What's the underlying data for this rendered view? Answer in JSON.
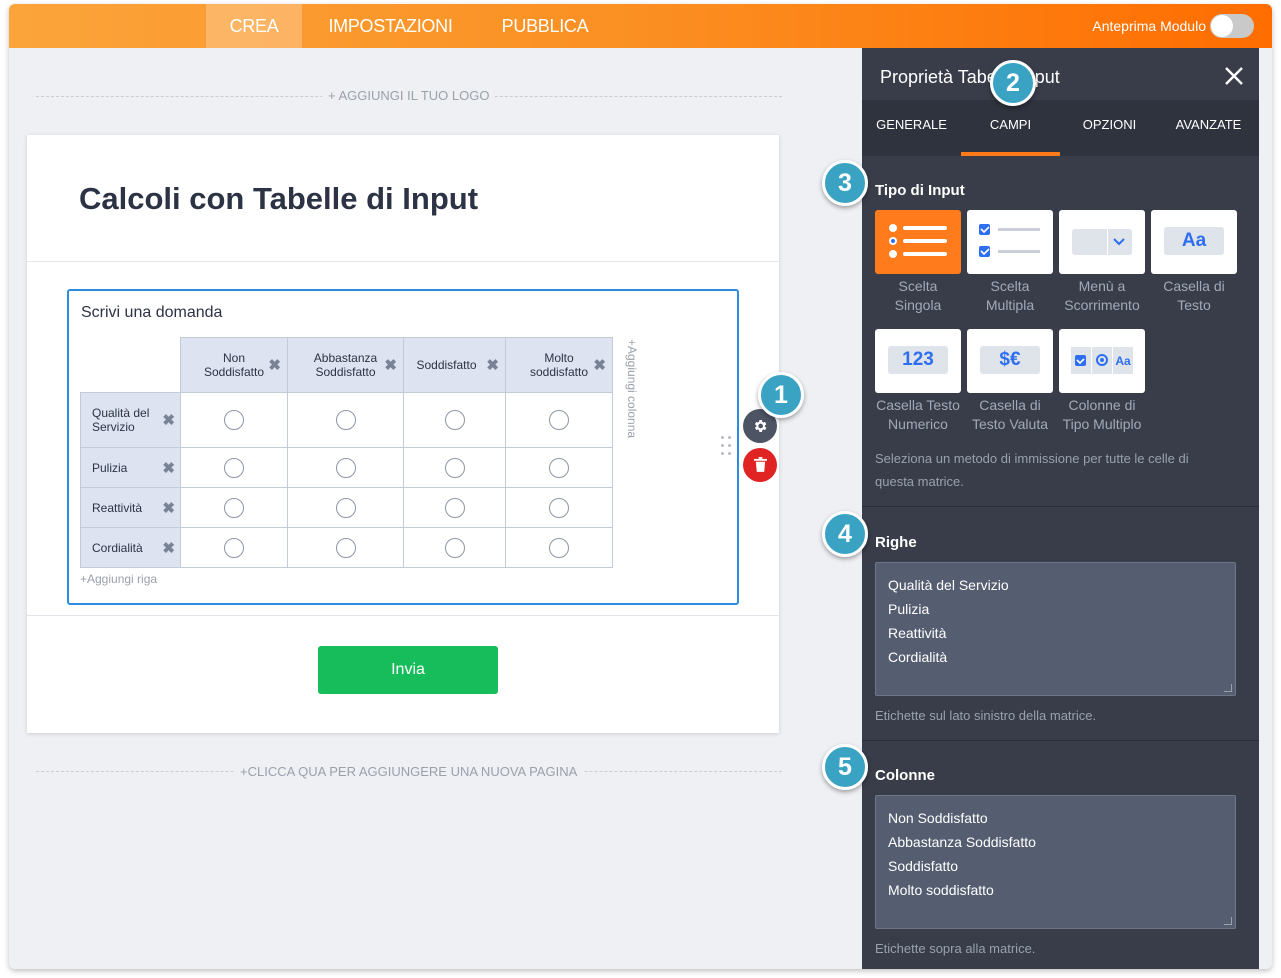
{
  "topbar": {
    "tabs": [
      "CREA",
      "IMPOSTAZIONI",
      "PUBBLICA"
    ],
    "preview_label": "Anteprima Modulo"
  },
  "canvas": {
    "add_logo": "+ AGGIUNGI IL TUO LOGO",
    "add_page": "+CLICCA QUA PER AGGIUNGERE UNA NUOVA PAGINA",
    "form_title": "Calcoli con Tabelle di Input",
    "question_label": "Scrivi una domanda",
    "columns": [
      {
        "line1": "Non",
        "line2": "Soddisfatto"
      },
      {
        "line1": "Abbastanza",
        "line2": "Soddisfatto"
      },
      {
        "line1": "Soddisfatto",
        "line2": ""
      },
      {
        "line1": "Molto",
        "line2": "soddisfatto"
      }
    ],
    "rows": [
      {
        "line1": "Qualità del",
        "line2": "Servizio"
      },
      {
        "line1": "Pulizia",
        "line2": ""
      },
      {
        "line1": "Reattività",
        "line2": ""
      },
      {
        "line1": "Cordialità",
        "line2": ""
      }
    ],
    "add_column": "+Aggiungi colonna",
    "add_row": "+Aggiungi riga",
    "submit_label": "Invia",
    "delete_icon": "✖"
  },
  "panel": {
    "title": "Proprietà Tabella Input",
    "tabs": [
      "GENERALE",
      "CAMPI",
      "OPZIONI",
      "AVANZATE"
    ],
    "input_type": {
      "heading": "Tipo di Input",
      "options": [
        {
          "line1": "Scelta",
          "line2": "Singola"
        },
        {
          "line1": "Scelta",
          "line2": "Multipla"
        },
        {
          "line1": "Menù a",
          "line2": "Scorrimento"
        },
        {
          "line1": "Casella di",
          "line2": "Testo"
        },
        {
          "line1": "Casella Testo",
          "line2": "Numerico"
        },
        {
          "line1": "Casella di",
          "line2": "Testo Valuta"
        },
        {
          "line1": "Colonne di",
          "line2": "Tipo Multiplo"
        }
      ],
      "icon_text_aa": "Aa",
      "icon_text_num": "123",
      "icon_text_cur": "$€",
      "hint_line1": "Seleziona un metodo di immissione per tutte le celle di",
      "hint_line2": "questa matrice."
    },
    "rows_section": {
      "heading": "Righe",
      "values": [
        "Qualità del Servizio",
        "Pulizia",
        "Reattività",
        "Cordialità"
      ],
      "hint": "Etichette sul lato sinistro della matrice."
    },
    "cols_section": {
      "heading": "Colonne",
      "values": [
        "Non Soddisfatto",
        "Abbastanza Soddisfatto",
        "Soddisfatto",
        "Molto soddisfatto"
      ],
      "hint": "Etichette sopra alla matrice."
    }
  },
  "badges": [
    "1",
    "2",
    "3",
    "4",
    "5"
  ],
  "colors": {
    "accent": "#ff7b1c",
    "badge": "#3aa3c3",
    "submit": "#18bd5b",
    "delete": "#e02424",
    "selected_border": "#2e8ce0"
  }
}
